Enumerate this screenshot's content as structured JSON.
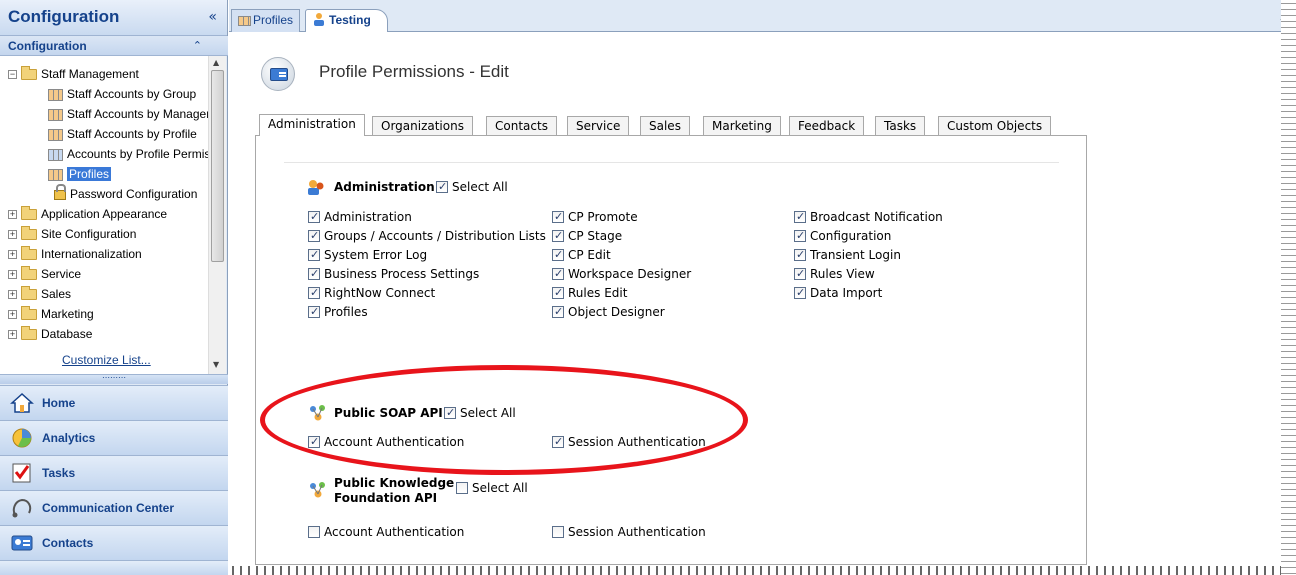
{
  "sidebar": {
    "title": "Configuration",
    "collapse_icon": "«",
    "section_title": "Configuration",
    "tree": [
      {
        "label": "Staff Management",
        "type": "folder",
        "expanded": true,
        "level": 0
      },
      {
        "label": "Staff Accounts by Group",
        "type": "report",
        "level": 1
      },
      {
        "label": "Staff Accounts by Manager",
        "type": "report",
        "level": 1
      },
      {
        "label": "Staff Accounts by Profile",
        "type": "report",
        "level": 1
      },
      {
        "label": "Accounts by Profile Permissions",
        "type": "report-blue",
        "level": 1
      },
      {
        "label": "Profiles",
        "type": "report",
        "level": 1,
        "selected": true
      },
      {
        "label": "Password Configuration",
        "type": "lock",
        "level": 1
      },
      {
        "label": "Application Appearance",
        "type": "folder",
        "level": 0
      },
      {
        "label": "Site Configuration",
        "type": "folder",
        "level": 0
      },
      {
        "label": "Internationalization",
        "type": "folder",
        "level": 0
      },
      {
        "label": "Service",
        "type": "folder",
        "level": 0
      },
      {
        "label": "Sales",
        "type": "folder",
        "level": 0
      },
      {
        "label": "Marketing",
        "type": "folder",
        "level": 0
      },
      {
        "label": "Database",
        "type": "folder",
        "level": 0
      }
    ],
    "customize_link": "Customize List...",
    "nav_buttons": [
      {
        "label": "Home",
        "icon": "home-icon"
      },
      {
        "label": "Analytics",
        "icon": "analytics-icon"
      },
      {
        "label": "Tasks",
        "icon": "tasks-icon"
      },
      {
        "label": "Communication Center",
        "icon": "communication-icon"
      },
      {
        "label": "Contacts",
        "icon": "contacts-icon"
      }
    ]
  },
  "doc_tabs": [
    {
      "label": "Profiles",
      "active": false
    },
    {
      "label": "Testing",
      "active": true
    }
  ],
  "page": {
    "title": "Profile Permissions - Edit",
    "tabs": [
      "Administration",
      "Organizations",
      "Contacts",
      "Service",
      "Sales",
      "Marketing",
      "Feedback",
      "Tasks",
      "Custom Objects"
    ],
    "active_tab": "Administration"
  },
  "sections": {
    "administration": {
      "title": "Administration",
      "select_all": "Select All",
      "select_all_checked": true,
      "columns": [
        [
          {
            "label": "Administration",
            "checked": true
          },
          {
            "label": "Groups / Accounts / Distribution Lists",
            "checked": true
          },
          {
            "label": "System Error Log",
            "checked": true
          },
          {
            "label": "Business Process Settings",
            "checked": true
          },
          {
            "label": "RightNow Connect",
            "checked": true
          },
          {
            "label": "Profiles",
            "checked": true
          }
        ],
        [
          {
            "label": "CP Promote",
            "checked": true
          },
          {
            "label": "CP Stage",
            "checked": true
          },
          {
            "label": "CP Edit",
            "checked": true
          },
          {
            "label": "Workspace Designer",
            "checked": true
          },
          {
            "label": "Rules Edit",
            "checked": true
          },
          {
            "label": "Object Designer",
            "checked": true
          }
        ],
        [
          {
            "label": "Broadcast Notification",
            "checked": true
          },
          {
            "label": "Configuration",
            "checked": true
          },
          {
            "label": "Transient Login",
            "checked": true
          },
          {
            "label": "Rules View",
            "checked": true
          },
          {
            "label": "Data Import",
            "checked": true
          }
        ]
      ]
    },
    "soap": {
      "title": "Public SOAP API",
      "select_all": "Select All",
      "select_all_checked": true,
      "items": [
        {
          "label": "Account Authentication",
          "checked": true
        },
        {
          "label": "Session Authentication",
          "checked": true
        }
      ]
    },
    "knowledge": {
      "title_line1": "Public Knowledge",
      "title_line2": "Foundation API",
      "select_all": "Select All",
      "select_all_checked": false,
      "items": [
        {
          "label": "Account Authentication",
          "checked": false
        },
        {
          "label": "Session Authentication",
          "checked": false
        }
      ]
    }
  },
  "colors": {
    "accent": "#15428b",
    "highlight": "#e8141b",
    "selection": "#3a79d8"
  }
}
